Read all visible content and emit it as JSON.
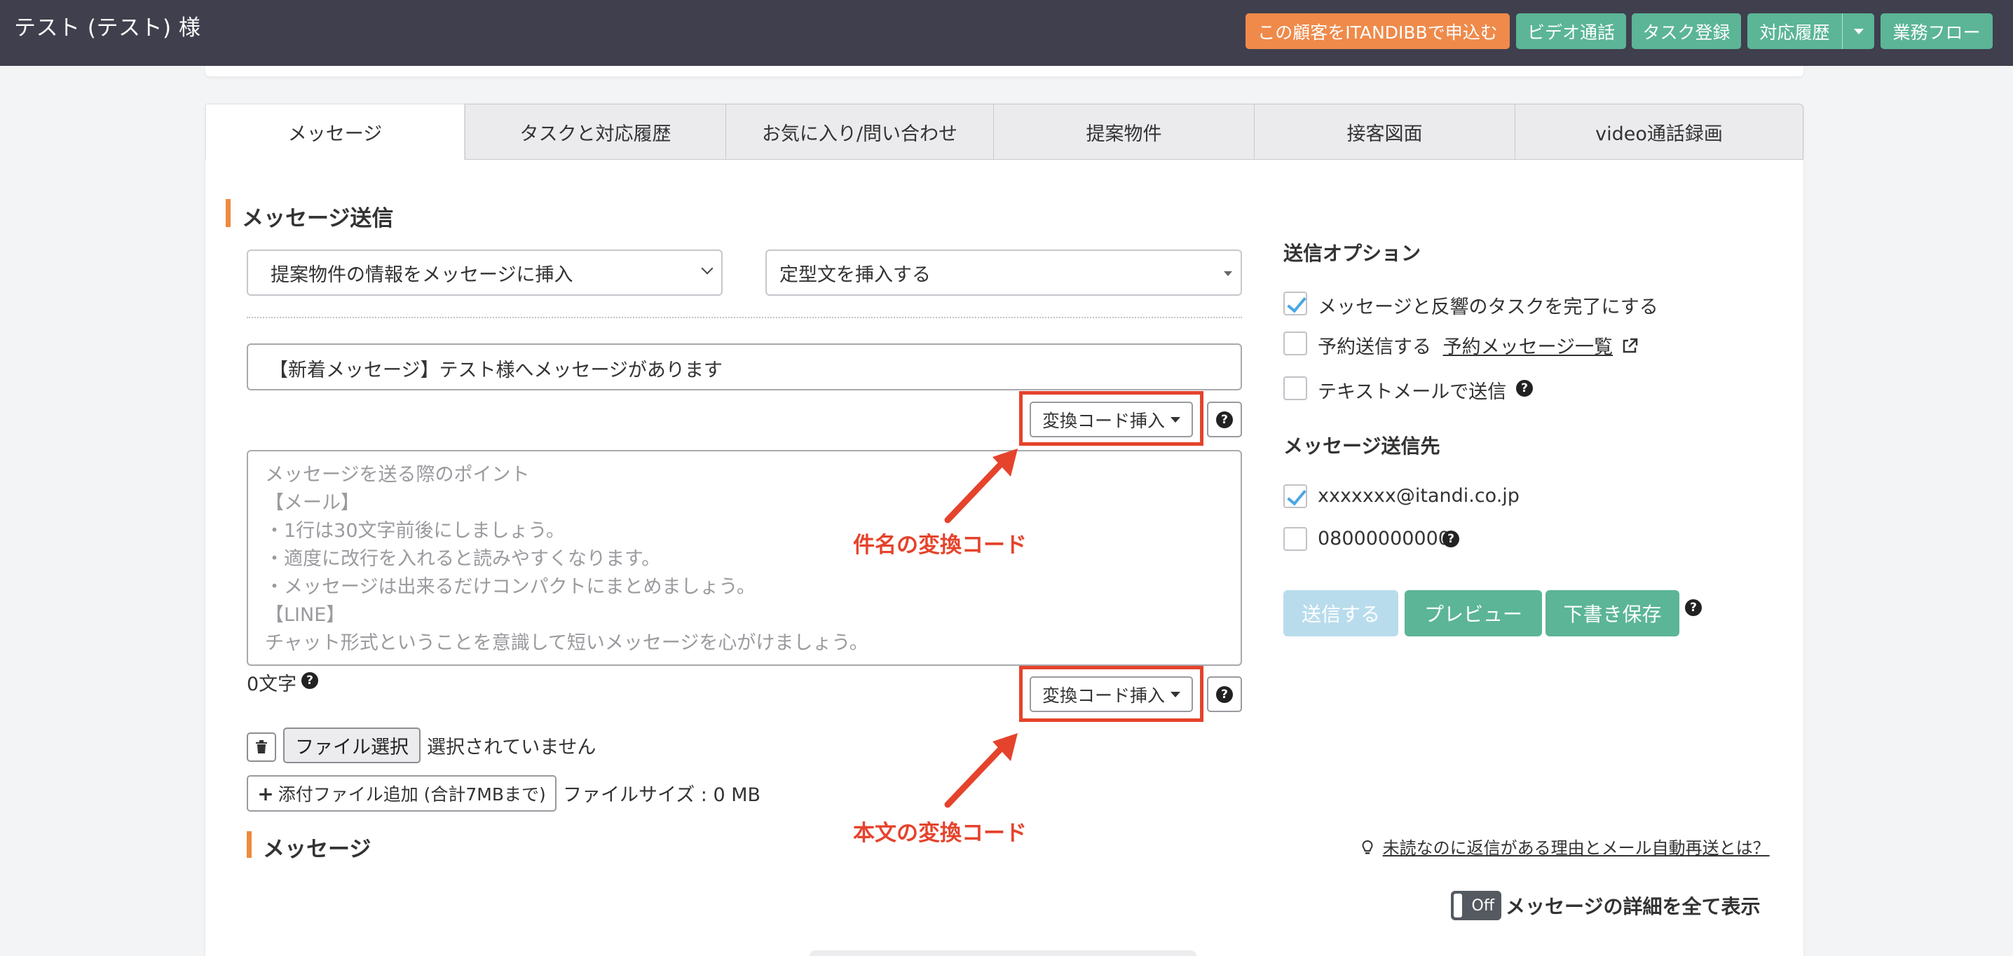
{
  "header": {
    "customer_name": "テスト (テスト) 様",
    "btn_apply": "この顧客をITANDIBBで申込む",
    "btn_video": "ビデオ通話",
    "btn_task": "タスク登録",
    "btn_history": "対応履歴",
    "btn_workflow": "業務フロー"
  },
  "tabs": [
    "メッセージ",
    "タスクと対応履歴",
    "お気に入り/問い合わせ",
    "提案物件",
    "接客図面",
    "video通話録画"
  ],
  "compose": {
    "section_title": "メッセージ送信",
    "property_select": "提案物件の情報をメッセージに挿入",
    "template_select": "定型文を挿入する",
    "subject_value": "【新着メッセージ】テスト様へメッセージがあります",
    "code_insert_label": "変換コード挿入",
    "body_placeholder": [
      "メッセージを送る際のポイント",
      "【メール】",
      "・1行は30文字前後にしましょう。",
      "・適度に改行を入れると読みやすくなります。",
      "・メッセージは出来るだけコンパクトにまとめましょう。",
      "【LINE】",
      "チャット形式ということを意識して短いメッセージを心がけましょう。"
    ],
    "char_count": "0文字",
    "file_select_label": "ファイル選択",
    "file_none": "選択されていません",
    "add_attachment": "添付ファイル追加 (合計7MBまで)",
    "file_size": "ファイルサイズ : 0 MB"
  },
  "annotations": {
    "subject_code": "件名の変換コード",
    "body_code": "本文の変換コード"
  },
  "options": {
    "title": "送信オプション",
    "complete_task": "メッセージと反響のタスクを完了にする",
    "complete_task_checked": true,
    "scheduled_send": "予約送信する",
    "scheduled_list_link": "予約メッセージ一覧",
    "scheduled_checked": false,
    "sms_send": "テキストメールで送信",
    "sms_checked": false
  },
  "recipients": {
    "title": "メッセージ送信先",
    "email": "xxxxxxx@itandi.co.jp",
    "email_checked": true,
    "phone": "08000000000",
    "phone_checked": false
  },
  "actions": {
    "send": "送信する",
    "preview": "プレビュー",
    "save_draft": "下書き保存"
  },
  "messages": {
    "section_title": "メッセージ",
    "help_link": "未読なのに返信がある理由とメール自動再送とは？",
    "toggle_state": "Off",
    "show_all_details": "メッセージの詳細を全て表示"
  },
  "colors": {
    "header_bg": "#3f3f4d",
    "orange": "#ef8a4a",
    "green": "#5bb596",
    "annotation_red": "#e5432c",
    "send_disabled": "#b9dcec"
  }
}
